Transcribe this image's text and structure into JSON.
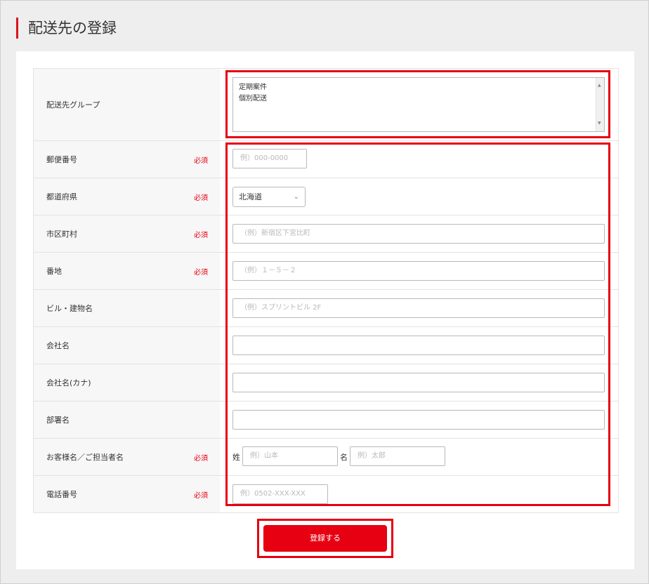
{
  "page": {
    "title": "配送先の登録"
  },
  "required_label": "必須",
  "group": {
    "label": "配送先グループ",
    "options": [
      "定期案件",
      "個別配送"
    ]
  },
  "fields": {
    "postal": {
      "label": "郵便番号",
      "placeholder": "例）000-0000"
    },
    "prefecture": {
      "label": "都道府県",
      "value": "北海道"
    },
    "city": {
      "label": "市区町村",
      "placeholder": "（例）新宿区下宮比町"
    },
    "address": {
      "label": "番地",
      "placeholder": "（例）１－５－２"
    },
    "building": {
      "label": "ビル・建物名",
      "placeholder": "（例）スプリントビル 2F"
    },
    "company": {
      "label": "会社名"
    },
    "company_kana": {
      "label": "会社名(カナ)"
    },
    "department": {
      "label": "部署名"
    },
    "person": {
      "label": "お客様名／ご担当者名",
      "last_label": "姓",
      "last_placeholder": "例）山本",
      "first_label": "名",
      "first_placeholder": "例）太郎"
    },
    "phone": {
      "label": "電話番号",
      "placeholder": "例）0502-XXX-XXX"
    }
  },
  "submit": {
    "label": "登録する"
  },
  "colors": {
    "accent": "#e60012"
  }
}
